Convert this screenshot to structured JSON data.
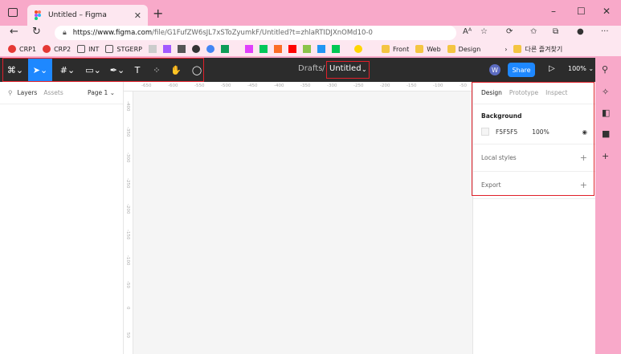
{
  "browser": {
    "tab_title": "Untitled – Figma",
    "new_tab": "+",
    "url_host": "https://www.figma.com",
    "url_rest": "/file/G1FufZW6sJL7xSToZyumkF/Untitled?t=zhlaRTIDJXnOMd10-0",
    "window_controls": [
      "–",
      "☐",
      "✕"
    ]
  },
  "bookmarks": [
    {
      "label": "CRP1",
      "color": "#e53935"
    },
    {
      "label": "CRP2",
      "color": "#e53935"
    },
    {
      "label": "INT",
      "color": "#ffffff"
    },
    {
      "label": "STGERP",
      "color": "#ffffff"
    },
    {
      "label": "Front",
      "color": "#f4c542"
    },
    {
      "label": "Web",
      "color": "#f4c542"
    },
    {
      "label": "Design",
      "color": "#f4c542"
    },
    {
      "label": "다른 즐겨찾기",
      "color": "#f4c542"
    }
  ],
  "toolbar": {
    "drafts": "Drafts",
    "separator": "/",
    "file_title": "Untitled",
    "avatar": "W",
    "share": "Share",
    "zoom": "100%"
  },
  "left_panel": {
    "layers": "Layers",
    "assets": "Assets",
    "page": "Page 1"
  },
  "ruler": {
    "h_labels": [
      "-650",
      "-600",
      "-550",
      "-500",
      "-450",
      "-400",
      "-350",
      "-300",
      "-250",
      "-200",
      "-150",
      "-100",
      "-50"
    ],
    "v_labels": [
      "-400",
      "-350",
      "-300",
      "-250",
      "-200",
      "-150",
      "-100",
      "-50",
      "0",
      "50"
    ]
  },
  "right_panel": {
    "tabs": [
      "Design",
      "Prototype",
      "Inspect"
    ],
    "background_header": "Background",
    "bg_hex": "F5F5F5",
    "bg_opacity": "100%",
    "local_styles": "Local styles",
    "export": "Export"
  },
  "colors": {
    "accent": "#1e88ff",
    "highlight": "#e0202a",
    "canvas": "#f5f5f5"
  }
}
